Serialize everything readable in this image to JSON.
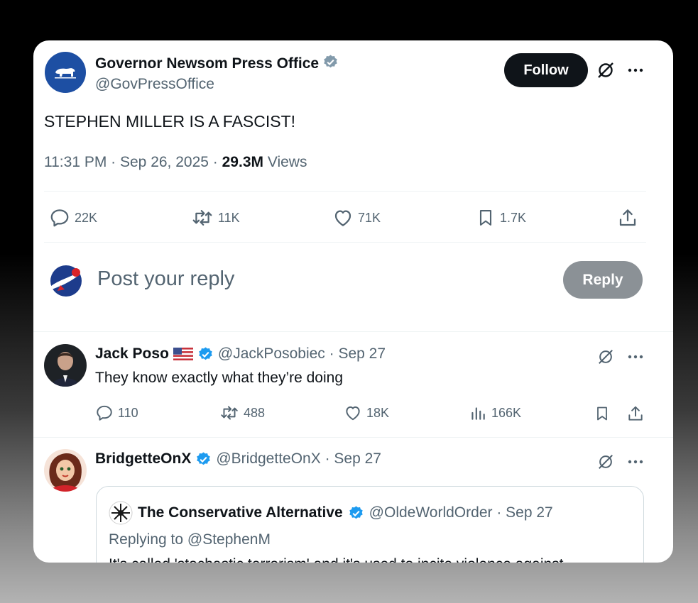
{
  "tweet": {
    "author_name": "Governor Newsom Press Office",
    "author_handle": "@GovPressOffice",
    "follow_label": "Follow",
    "text": "STEPHEN MILLER IS A FASCIST!",
    "time": "11:31 PM",
    "sep1": " · ",
    "date": "Sep 26, 2025",
    "sep2": " · ",
    "views_count": "29.3M",
    "views_label": " Views",
    "stats": {
      "replies": "22K",
      "reposts": "11K",
      "likes": "71K",
      "bookmarks": "1.7K"
    }
  },
  "composer": {
    "placeholder": "Post your reply",
    "reply_label": "Reply"
  },
  "replies": [
    {
      "name": "Jack Poso",
      "handle_date": "@JackPosobiec · Sep 27",
      "text": "They know exactly what they’re doing",
      "stats": {
        "replies": "110",
        "reposts": "488",
        "likes": "18K",
        "views": "166K"
      }
    },
    {
      "name": "BridgetteOnX",
      "handle_date": "@BridgetteOnX · Sep 27",
      "quote": {
        "name": "The Conservative Alternative",
        "handle_date": "@OldeWorldOrder · Sep 27",
        "replying_to": "Replying to @StephenM",
        "text_partial": "It's called 'stochastic terrorism' and it's used to incite violence against"
      }
    }
  ],
  "colors": {
    "verified": "#1d9bf0",
    "text": "#0f1419",
    "muted": "#536471",
    "brand_blue": "#1d4fa3"
  },
  "icons": [
    "california-bear-icon",
    "verified-icon",
    "grok-icon",
    "more-icon",
    "reply-icon",
    "repost-icon",
    "like-icon",
    "bookmark-icon",
    "share-icon",
    "views-icon",
    "us-flag-icon",
    "snowflake-icon"
  ]
}
